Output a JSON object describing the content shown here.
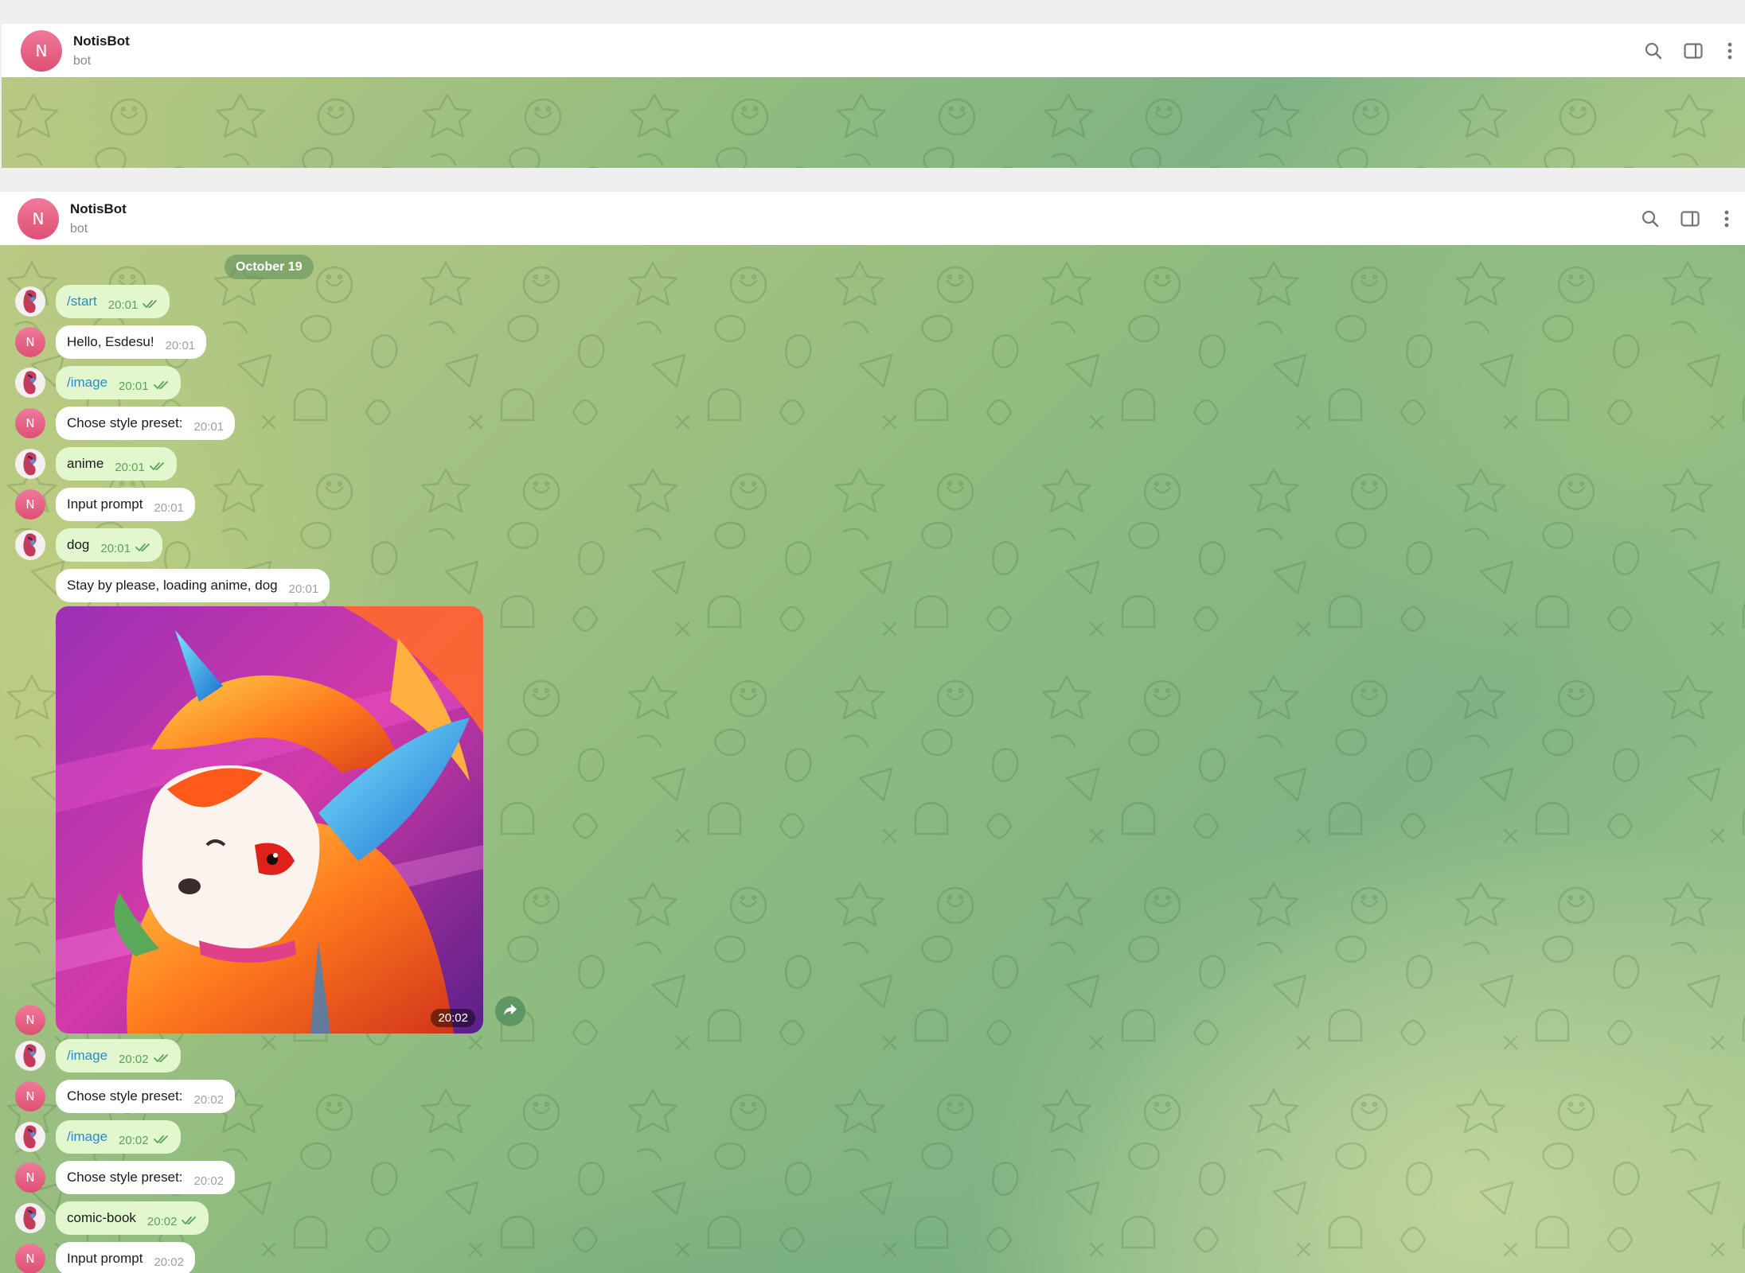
{
  "window_top": {
    "title": "NotisBot",
    "subtitle": "bot",
    "avatar_letter": "N"
  },
  "window_main": {
    "title": "NotisBot",
    "subtitle": "bot",
    "avatar_letter": "N"
  },
  "header_icons": [
    "search-icon",
    "sidebar-toggle-icon",
    "more-vertical-icon"
  ],
  "chat": {
    "date_label": "October 19",
    "messages": [
      {
        "from": "user",
        "text": "/start",
        "time": "20:01"
      },
      {
        "from": "bot",
        "text": "Hello, Esdesu!",
        "time": "20:01"
      },
      {
        "from": "user",
        "text": "/image",
        "time": "20:01"
      },
      {
        "from": "bot",
        "text": "Chose style preset:",
        "time": "20:01"
      },
      {
        "from": "user",
        "text": "anime",
        "time": "20:01"
      },
      {
        "from": "bot",
        "text": "Input prompt",
        "time": "20:01"
      },
      {
        "from": "user",
        "text": "dog",
        "time": "20:01"
      },
      {
        "from": "bot",
        "text": "Stay by please, loading anime, dog",
        "time": "20:01"
      },
      {
        "from": "bot",
        "type": "photo",
        "time": "20:02"
      },
      {
        "from": "user",
        "text": "/image",
        "time": "20:02"
      },
      {
        "from": "bot",
        "text": "Chose style preset:",
        "time": "20:02"
      },
      {
        "from": "user",
        "text": "/image",
        "time": "20:02"
      },
      {
        "from": "bot",
        "text": "Chose style preset:",
        "time": "20:02"
      },
      {
        "from": "user",
        "text": "comic-book",
        "time": "20:02"
      },
      {
        "from": "bot",
        "text": "Input prompt",
        "time": "20:02"
      }
    ]
  },
  "colors": {
    "bot_avatar": "#dd4f74",
    "outgoing_bubble": "#e2f7ce",
    "incoming_bubble": "#ffffff",
    "command_link": "#2a8ad0",
    "read_ticks": "#5aa35a"
  }
}
